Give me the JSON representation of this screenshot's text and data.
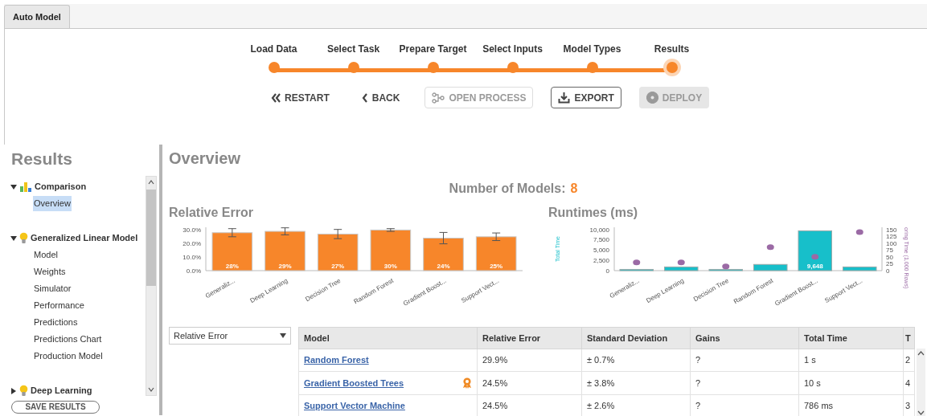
{
  "tab": {
    "label": "Auto Model",
    "selected": true
  },
  "steps": [
    {
      "label": "Load Data",
      "selected": false
    },
    {
      "label": "Select Task",
      "selected": false
    },
    {
      "label": "Prepare Target",
      "selected": false
    },
    {
      "label": "Select Inputs",
      "selected": false
    },
    {
      "label": "Model Types",
      "selected": false
    },
    {
      "label": "Results",
      "selected": true
    }
  ],
  "actions": [
    {
      "label": "RESTART",
      "kind": "text",
      "disabled": false
    },
    {
      "label": "BACK",
      "kind": "text",
      "disabled": false
    },
    {
      "label": "OPEN PROCESS",
      "kind": "outline",
      "disabled": true
    },
    {
      "label": "EXPORT",
      "kind": "outline",
      "disabled": false
    },
    {
      "label": "DEPLOY",
      "kind": "filled",
      "disabled": true
    }
  ],
  "sidebar": {
    "title": "Results",
    "tree": [
      {
        "label": "Comparison",
        "kind": "comparison",
        "expanded": true,
        "children": [
          {
            "label": "Overview",
            "selected": true
          }
        ]
      },
      {
        "label": "Generalized Linear Model",
        "kind": "model",
        "expanded": true,
        "children": [
          {
            "label": "Model",
            "selected": false
          },
          {
            "label": "Weights",
            "selected": false
          },
          {
            "label": "Simulator",
            "selected": false
          },
          {
            "label": "Performance",
            "selected": false
          },
          {
            "label": "Predictions",
            "selected": false
          },
          {
            "label": "Predictions Chart",
            "selected": false
          },
          {
            "label": "Production Model",
            "selected": false
          }
        ]
      },
      {
        "label": "Deep Learning",
        "kind": "model",
        "expanded": false
      }
    ],
    "save_button": "SAVE RESULTS"
  },
  "main": {
    "title": "Overview",
    "model_count_label": "Number of Models:",
    "model_count": "8",
    "charts": [
      {
        "title": "Relative Error",
        "chart_data": {
          "type": "bar",
          "categories": [
            "Generaliz...",
            "Deep Learning",
            "Decision Tree",
            "Random Forest",
            "Gradient Boost...",
            "Support Vect..."
          ],
          "series": [
            {
              "color": "#f7862a",
              "values": [
                28,
                29,
                27,
                30,
                24,
                25
              ],
              "errors": [
                3,
                2.6,
                3.4,
                1,
                4.2,
                2.8
              ]
            }
          ],
          "ylim": [
            0,
            32
          ],
          "yticks": [
            {
              "value": 0,
              "label": "0.0%"
            },
            {
              "value": 10,
              "label": "10.0%"
            },
            {
              "value": 20,
              "label": "20.0%"
            },
            {
              "value": 30,
              "label": "30.0%"
            }
          ],
          "value_labels": [
            "28%",
            "29%",
            "27%",
            "30%",
            "24%",
            "25%"
          ]
        }
      },
      {
        "title": "Runtimes (ms)",
        "chart_data": {
          "type": "bar",
          "categories": [
            "Generaliz...",
            "Deep Learning",
            "Decision Tree",
            "Random Forest",
            "Gradient Boost...",
            "Support Vect..."
          ],
          "ylabel": "Total Time",
          "y2label": "oring Time (1,000 Rows)",
          "series": [
            {
              "color": "#17bfca",
              "values": [
                300,
                900,
                300,
                1500,
                9648,
                900
              ]
            },
            {
              "color": "#9b6aa5",
              "values": [
                30,
                30,
                15,
                85,
                50,
                140
              ]
            }
          ],
          "ylim": [
            0,
            10500
          ],
          "yticks": [
            {
              "value": 0,
              "label": "0"
            },
            {
              "value": 2500,
              "label": "2,500"
            },
            {
              "value": 5000,
              "label": "5,000"
            },
            {
              "value": 7500,
              "label": "7,500"
            },
            {
              "value": 10000,
              "label": "10,000"
            }
          ],
          "y2lim": [
            0,
            157.5
          ],
          "y2ticks": [
            0,
            25,
            50,
            75,
            100,
            125,
            150
          ],
          "value_labels": [
            null,
            null,
            null,
            null,
            "9,648",
            null
          ]
        }
      }
    ],
    "metric_select": {
      "value": "Relative Error"
    },
    "table": {
      "columns": [
        "Model",
        "Relative Error",
        "Standard Deviation",
        "Gains",
        "Total Time",
        "T"
      ],
      "rows": [
        {
          "recommended": false,
          "cells": [
            "Random Forest",
            "29.9%",
            "± 0.7%",
            "?",
            "1 s",
            "2"
          ]
        },
        {
          "recommended": true,
          "cells": [
            "Gradient Boosted Trees",
            "24.5%",
            "± 3.8%",
            "?",
            "10 s",
            "4"
          ]
        },
        {
          "recommended": false,
          "cells": [
            "Support Vector Machine",
            "24.5%",
            "± 2.6%",
            "?",
            "786 ms",
            "3"
          ]
        }
      ]
    }
  }
}
